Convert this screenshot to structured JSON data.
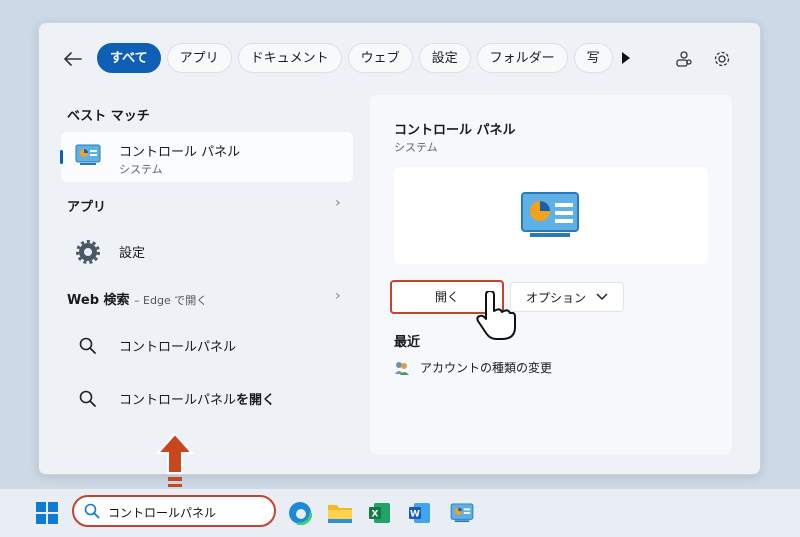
{
  "filter_bar": {
    "back_icon": "arrow-left-icon",
    "tabs": [
      "すべて",
      "アプリ",
      "ドキュメント",
      "ウェブ",
      "設定",
      "フォルダー",
      "写"
    ],
    "active_tab": 0,
    "account_icon": "account-switch-icon",
    "settings_icon": "gear-icon"
  },
  "left": {
    "best_match_heading": "ベスト マッチ",
    "best_match": {
      "title": "コントロール パネル",
      "subtitle": "システム",
      "icon": "control-panel-icon"
    },
    "apps_heading": "アプリ",
    "apps": [
      {
        "label": "設定",
        "icon": "gear-icon"
      }
    ],
    "web_heading": "Web 検索",
    "web_sub": "– Edge で開く",
    "web_results": [
      {
        "label": "コントロールパネル",
        "icon": "search-icon"
      },
      {
        "label_normal": "コントロールパネル",
        "label_bold": "を開く",
        "icon": "search-icon"
      }
    ]
  },
  "preview": {
    "title": "コントロール パネル",
    "subtitle": "システム",
    "open_label": "開く",
    "options_label": "オプション",
    "recent_heading": "最近",
    "recent_items": [
      {
        "label": "アカウントの種類の変更",
        "icon": "users-icon"
      }
    ]
  },
  "taskbar": {
    "search_value": "コントロールパネル",
    "apps": [
      "windows-start-icon",
      "edge-icon",
      "file-explorer-icon",
      "excel-icon",
      "word-icon",
      "control-panel-icon"
    ]
  },
  "colors": {
    "accent": "#0f5fb6",
    "highlight": "#c0442f",
    "arrow": "#c8471f"
  }
}
